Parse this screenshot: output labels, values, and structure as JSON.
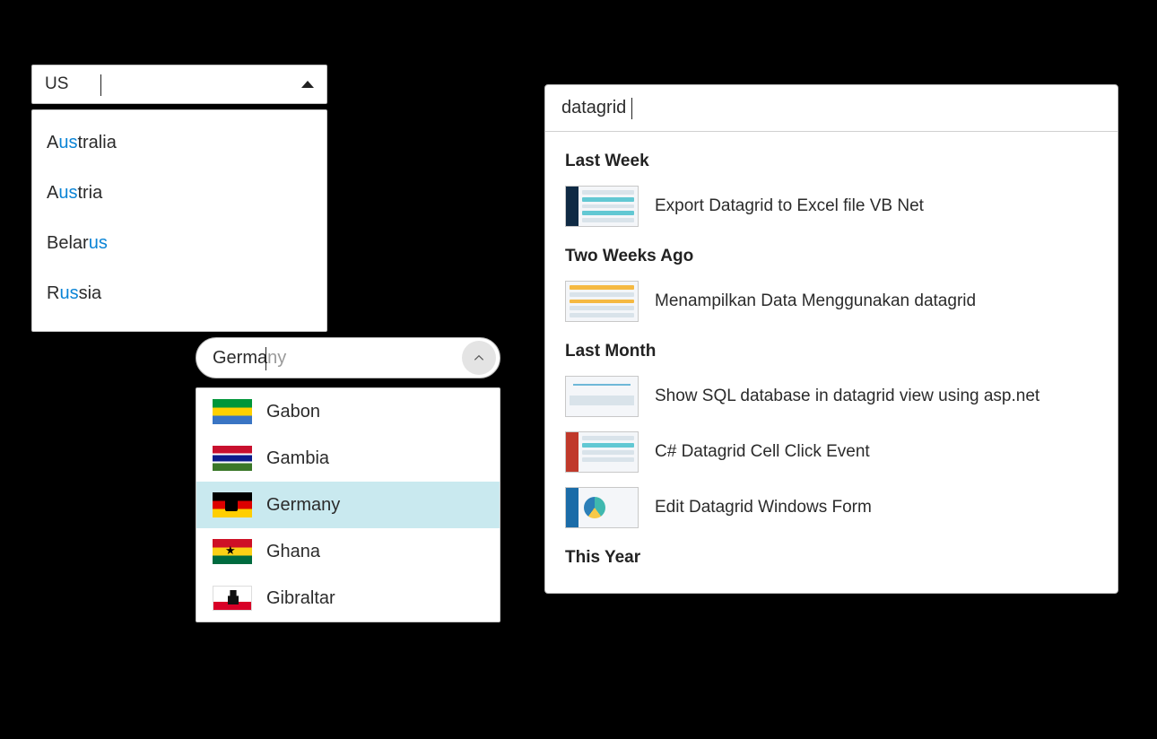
{
  "combo1": {
    "query": "US",
    "items": [
      {
        "pre": "A",
        "match": "us",
        "post": "tralia"
      },
      {
        "pre": "A",
        "match": "us",
        "post": "tria"
      },
      {
        "pre": "Belar",
        "match": "us",
        "post": ""
      },
      {
        "pre": "R",
        "match": "us",
        "post": "sia"
      }
    ]
  },
  "combo2": {
    "typed": "Germa",
    "suggest": "ny",
    "items": [
      {
        "label": "Gabon",
        "flag": "gabon"
      },
      {
        "label": "Gambia",
        "flag": "gambia"
      },
      {
        "label": "Germany",
        "flag": "germany",
        "selected": true
      },
      {
        "label": "Ghana",
        "flag": "ghana"
      },
      {
        "label": "Gibraltar",
        "flag": "gibraltar"
      }
    ]
  },
  "search": {
    "query": "datagrid",
    "groups": [
      {
        "title": "Last Week",
        "items": [
          {
            "label": "Export Datagrid to Excel file VB Net",
            "thumb": "sidebar-bars"
          }
        ]
      },
      {
        "title": "Two Weeks Ago",
        "items": [
          {
            "label": "Menampilkan Data Menggunakan datagrid",
            "thumb": "table-orange"
          }
        ]
      },
      {
        "title": "Last Month",
        "items": [
          {
            "label": "Show SQL database in datagrid view using asp.net",
            "thumb": "line-chart"
          },
          {
            "label": "C# Datagrid Cell Click Event",
            "thumb": "red-side"
          },
          {
            "label": "Edit Datagrid Windows Form",
            "thumb": "pie-side"
          }
        ]
      },
      {
        "title": "This Year",
        "items": []
      }
    ]
  }
}
